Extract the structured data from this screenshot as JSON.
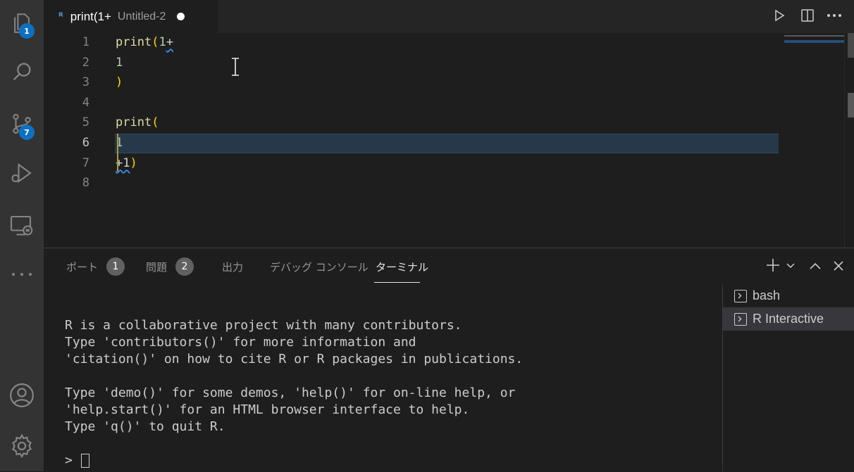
{
  "activity_bar": {
    "explorer_badge": "1",
    "source_control_badge": "7"
  },
  "editor_tab": {
    "title": "print(1+",
    "description": "Untitled-2"
  },
  "editor": {
    "lines": [
      {
        "number": "1",
        "tokens": [
          {
            "t": "print",
            "c": "fn"
          },
          {
            "t": "(",
            "c": "par"
          },
          {
            "t": "1",
            "c": "num"
          },
          {
            "t": "+",
            "c": "op",
            "squiggle": true
          }
        ]
      },
      {
        "number": "2",
        "tokens": [
          {
            "t": "1",
            "c": "num"
          }
        ]
      },
      {
        "number": "3",
        "tokens": [
          {
            "t": ")",
            "c": "par"
          }
        ]
      },
      {
        "number": "4",
        "tokens": []
      },
      {
        "number": "5",
        "tokens": [
          {
            "t": "print",
            "c": "fn"
          },
          {
            "t": "(",
            "c": "par"
          }
        ]
      },
      {
        "number": "6",
        "tokens": [
          {
            "t": "1",
            "c": "num"
          }
        ]
      },
      {
        "number": "7",
        "tokens": [
          {
            "t": "+1",
            "c": "op",
            "squiggle": true
          },
          {
            "t": ")",
            "c": "par"
          }
        ]
      },
      {
        "number": "8",
        "tokens": []
      }
    ],
    "active_line": "6"
  },
  "panel": {
    "tabs": [
      {
        "label": "ポート",
        "count": "1"
      },
      {
        "label": "問題",
        "count": "2"
      },
      {
        "label": "出力"
      },
      {
        "label": "デバッグ コンソール"
      },
      {
        "label": "ターミナル"
      }
    ],
    "active_tab": "ターミナル",
    "terminal_lines": [
      "R is a collaborative project with many contributors.",
      "Type 'contributors()' for more information and",
      "'citation()' on how to cite R or R packages in publications.",
      "",
      "Type 'demo()' for some demos, 'help()' for on-line help, or",
      "'help.start()' for an HTML browser interface to help.",
      "Type 'q()' to quit R.",
      "",
      "> "
    ],
    "terminals": [
      "bash",
      "R Interactive"
    ],
    "selected_terminal": "R Interactive"
  },
  "colors": {
    "accent": "#0e70c0",
    "activity_bg": "#333333",
    "editor_bg": "#1e1e1e"
  }
}
